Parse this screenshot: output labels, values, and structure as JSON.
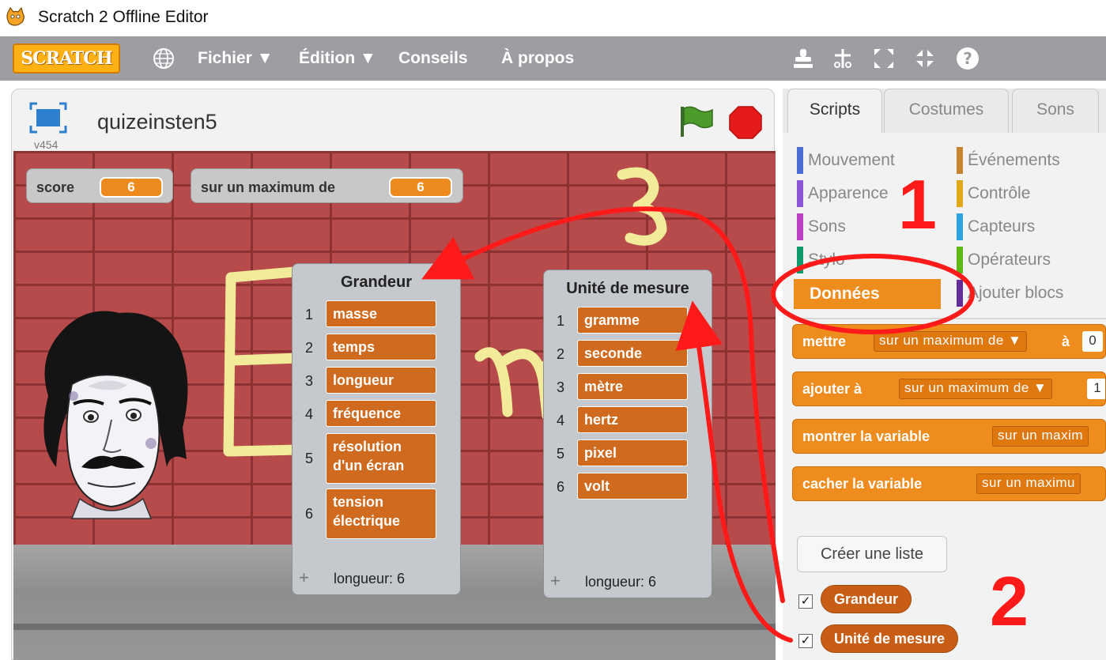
{
  "window": {
    "title": "Scratch 2 Offline Editor"
  },
  "menubar": {
    "logo": "SCRATCH",
    "items": [
      "Fichier ▼",
      "Édition ▼",
      "Conseils",
      "À propos"
    ]
  },
  "project": {
    "title": "quizeinsten5",
    "version": "v454"
  },
  "monitors": [
    {
      "label": "score",
      "value": "6"
    },
    {
      "label": "sur un maximum de",
      "value": "6"
    }
  ],
  "lists": [
    {
      "title": "Grandeur",
      "items": [
        {
          "index": "1",
          "value": "masse"
        },
        {
          "index": "2",
          "value": "temps"
        },
        {
          "index": "3",
          "value": "longueur"
        },
        {
          "index": "4",
          "value": "fréquence"
        },
        {
          "index": "5",
          "value": "résolution d'un écran"
        },
        {
          "index": "6",
          "value": "tension électrique"
        }
      ],
      "length_label": "longueur: 6"
    },
    {
      "title": "Unité de mesure",
      "items": [
        {
          "index": "1",
          "value": "gramme"
        },
        {
          "index": "2",
          "value": "seconde"
        },
        {
          "index": "3",
          "value": "mètre"
        },
        {
          "index": "4",
          "value": "hertz"
        },
        {
          "index": "5",
          "value": "pixel"
        },
        {
          "index": "6",
          "value": "volt"
        }
      ],
      "length_label": "longueur: 6"
    }
  ],
  "tabs": [
    "Scripts",
    "Costumes",
    "Sons"
  ],
  "categories": {
    "left": [
      {
        "label": "Mouvement",
        "color": "#4a6cd4"
      },
      {
        "label": "Apparence",
        "color": "#8a55d7"
      },
      {
        "label": "Sons",
        "color": "#bb42c3"
      },
      {
        "label": "Stylo",
        "color": "#0e9a6c"
      },
      {
        "label": "Données",
        "color": "#ee7d16",
        "active": true
      }
    ],
    "right": [
      {
        "label": "Événements",
        "color": "#c88330"
      },
      {
        "label": "Contrôle",
        "color": "#e1a91a"
      },
      {
        "label": "Capteurs",
        "color": "#2ca5e2"
      },
      {
        "label": "Opérateurs",
        "color": "#5cb712"
      },
      {
        "label": "Ajouter blocs",
        "color": "#632d99"
      }
    ]
  },
  "blocks": [
    {
      "text": "mettre",
      "input": "sur un maximum de ▼",
      "suffix": "à",
      "value": "0"
    },
    {
      "text": "ajouter à",
      "input": "sur un maximum de ▼",
      "value": "1"
    },
    {
      "text": "montrer la variable",
      "input": "sur un maxim"
    },
    {
      "text": "cacher la variable",
      "input": "sur un maximu"
    }
  ],
  "create_list_label": "Créer une liste",
  "list_reporters": [
    "Grandeur",
    "Unité de mesure"
  ],
  "annotations": [
    "1",
    "2"
  ],
  "colors": {
    "accent": "#ee8c1e",
    "annotation": "#ff1a1a",
    "menubar": "#9c9ea2"
  }
}
